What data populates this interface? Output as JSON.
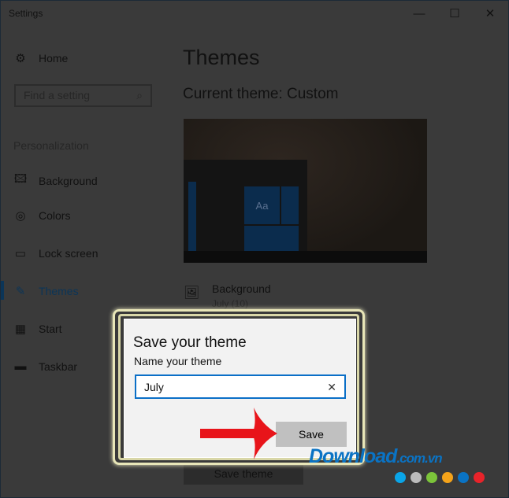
{
  "window": {
    "title": "Settings",
    "minimize": "—",
    "maximize": "☐",
    "close": "✕"
  },
  "sidebar": {
    "home": "Home",
    "search_placeholder": "Find a setting",
    "section": "Personalization",
    "items": [
      {
        "label": "Background",
        "icon": "image-icon"
      },
      {
        "label": "Colors",
        "icon": "palette-icon"
      },
      {
        "label": "Lock screen",
        "icon": "lock-screen-icon"
      },
      {
        "label": "Themes",
        "icon": "themes-icon",
        "active": true
      },
      {
        "label": "Start",
        "icon": "start-icon"
      },
      {
        "label": "Taskbar",
        "icon": "taskbar-icon"
      }
    ]
  },
  "main": {
    "title": "Themes",
    "current_theme": "Current theme: Custom",
    "preview_tile_text": "Aa",
    "background_label": "Background",
    "background_value": "July (10)",
    "save_theme": "Save theme"
  },
  "dialog": {
    "title": "Save your theme",
    "label": "Name your theme",
    "input_value": "July",
    "clear": "✕",
    "save": "Save"
  },
  "watermark": {
    "text": "Download.com.vn",
    "dot_colors": [
      "#0aa5e8",
      "#bbbbbb",
      "#7cc43a",
      "#f5a31a",
      "#0a73c4",
      "#e8232a"
    ]
  },
  "colors": {
    "accent": "#0b6fc7",
    "arrow": "#e8141a"
  }
}
